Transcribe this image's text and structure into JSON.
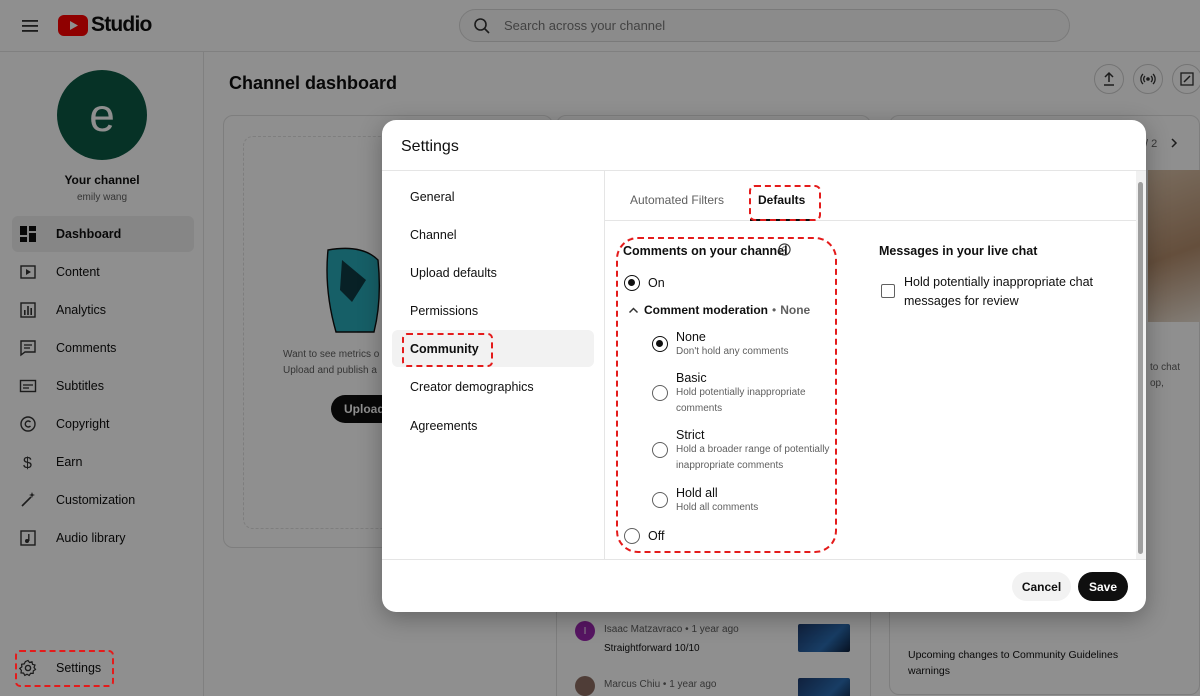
{
  "app": {
    "name": "Studio"
  },
  "search": {
    "placeholder": "Search across your channel"
  },
  "sidebar": {
    "avatar_letter": "e",
    "channel_title": "Your channel",
    "channel_name": "emily wang",
    "items": [
      {
        "label": "Dashboard",
        "icon": "dashboard-icon",
        "active": true
      },
      {
        "label": "Content",
        "icon": "content-icon"
      },
      {
        "label": "Analytics",
        "icon": "analytics-icon"
      },
      {
        "label": "Comments",
        "icon": "comments-icon"
      },
      {
        "label": "Subtitles",
        "icon": "subtitles-icon"
      },
      {
        "label": "Copyright",
        "icon": "copyright-icon"
      },
      {
        "label": "Earn",
        "icon": "dollar-icon"
      },
      {
        "label": "Customization",
        "icon": "magic-wand-icon"
      },
      {
        "label": "Audio library",
        "icon": "audio-library-icon"
      }
    ],
    "settings_label": "Settings"
  },
  "main": {
    "title": "Channel dashboard",
    "metrics_text_1": "Want to see metrics o",
    "metrics_text_2": "Upload and publish a",
    "upload_label": "Upload",
    "page_indicator": "/ 2",
    "right_text_1": "to chat",
    "right_text_2": "op,",
    "comments": [
      {
        "author": "Isaac Matzavraco",
        "time": "1 year ago",
        "text": "Straightforward 10/10",
        "avatar_letter": "I"
      },
      {
        "author": "Marcus Chiu",
        "time": "1 year ago",
        "text": ""
      }
    ],
    "news_title": "Upcoming changes to Community Guidelines warnings"
  },
  "modal": {
    "title": "Settings",
    "nav": [
      "General",
      "Channel",
      "Upload defaults",
      "Permissions",
      "Community",
      "Creator demographics",
      "Agreements"
    ],
    "active_nav": "Community",
    "tabs": [
      "Automated Filters",
      "Defaults"
    ],
    "active_tab": "Defaults",
    "comments_section": {
      "title": "Comments on your channel",
      "on_label": "On",
      "off_label": "Off",
      "selected": "On",
      "moderation_label": "Comment moderation",
      "moderation_value": "None",
      "options": [
        {
          "label": "None",
          "desc": "Don't hold any comments",
          "checked": true
        },
        {
          "label": "Basic",
          "desc": "Hold potentially inappropriate comments",
          "checked": false
        },
        {
          "label": "Strict",
          "desc": "Hold a broader range of potentially inappropriate comments",
          "checked": false
        },
        {
          "label": "Hold all",
          "desc": "Hold all comments",
          "checked": false
        }
      ]
    },
    "live_chat": {
      "title": "Messages in your live chat",
      "checkbox_label": "Hold potentially inappropriate chat messages for review",
      "checked": false
    },
    "cancel_label": "Cancel",
    "save_label": "Save"
  },
  "colors": {
    "highlight": "#e41b1b",
    "brand_red": "#ff0000",
    "avatar": "#0c5a44"
  }
}
